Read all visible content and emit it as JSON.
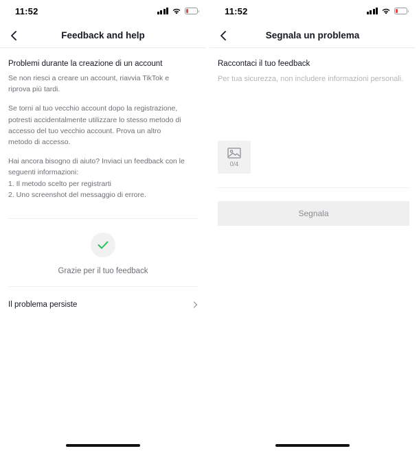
{
  "left": {
    "status": {
      "time": "11:52"
    },
    "nav": {
      "title": "Feedback and help"
    },
    "section_title": "Problemi durante la creazione di un account",
    "paragraphs": [
      "Se non riesci a creare un account, riavvia TikTok e\nriprova più  tardi.",
      "Se torni al tuo vecchio account dopo la registrazione,\npotresti  accidentalmente utilizzare lo stesso metodo di\naccesso del tuo vecchio  account. Prova un altro\nmetodo di accesso.",
      "Hai ancora bisogno di aiuto? Inviaci un feedback con le\nseguenti  informazioni:\n1. Il metodo scelto per registrarti\n2. Uno screenshot del messaggio di errore."
    ],
    "thanks_text": "Grazie per il tuo feedback",
    "persist_label": "Il problema persiste"
  },
  "right": {
    "status": {
      "time": "11:52"
    },
    "nav": {
      "title": "Segnala un problema"
    },
    "field_label": "Raccontaci il tuo feedback",
    "textarea": {
      "value": "",
      "placeholder": "Per tua sicurezza, non includere informazioni personali."
    },
    "image_count": "0/4",
    "submit_label": "Segnala"
  },
  "colors": {
    "accent_check": "#25c25a",
    "battery_low": "#e5484d",
    "text_primary": "#161823",
    "text_secondary": "#6f6f75",
    "button_bg": "#efeff0"
  },
  "icons": [
    "signal-icon",
    "wifi-icon",
    "battery-icon",
    "back-arrow-icon",
    "checkmark-icon",
    "chevron-right-icon",
    "image-icon"
  ]
}
